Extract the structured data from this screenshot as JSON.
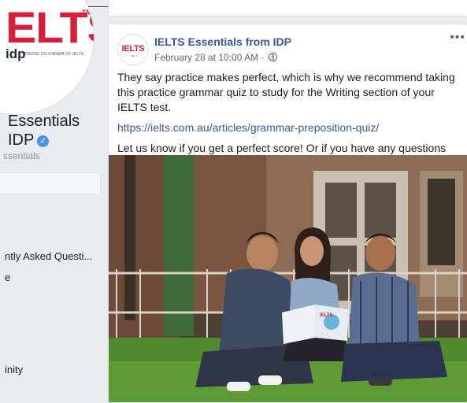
{
  "page": {
    "logo_text": "ELTS",
    "logo_tm": "TM",
    "logo_idp": "idp",
    "logo_tagline": "PROUD CO-OWNER OF IELTS",
    "name_line1": "Essentials",
    "name_line2": "IDP",
    "handle": "ssentials"
  },
  "left_nav": {
    "items": [
      {
        "label": "ntly Asked Questi..."
      },
      {
        "label": "e"
      },
      {
        "label": "inity"
      }
    ]
  },
  "post": {
    "avatar_text": "IELTS",
    "avatar_sub": "idp",
    "author": "IELTS Essentials from IDP",
    "timestamp": "February 28 at 10:00 AM ·",
    "more": "•••",
    "paragraph1": "They say practice makes perfect, which is why we recommend taking this practice grammar quiz to study for the Writing section of your IELTS test.",
    "link": "https://ielts.com.au/articles/grammar-preposition-quiz/",
    "paragraph2": "Let us know if you get a perfect score! Or if you have any questions about the IELTS test.",
    "photo_booklet_label": "IELTS"
  },
  "colors": {
    "brand_red": "#d6203a",
    "link_blue": "#385898",
    "verified_blue": "#4d8fe6",
    "background": "#e9ebee"
  }
}
